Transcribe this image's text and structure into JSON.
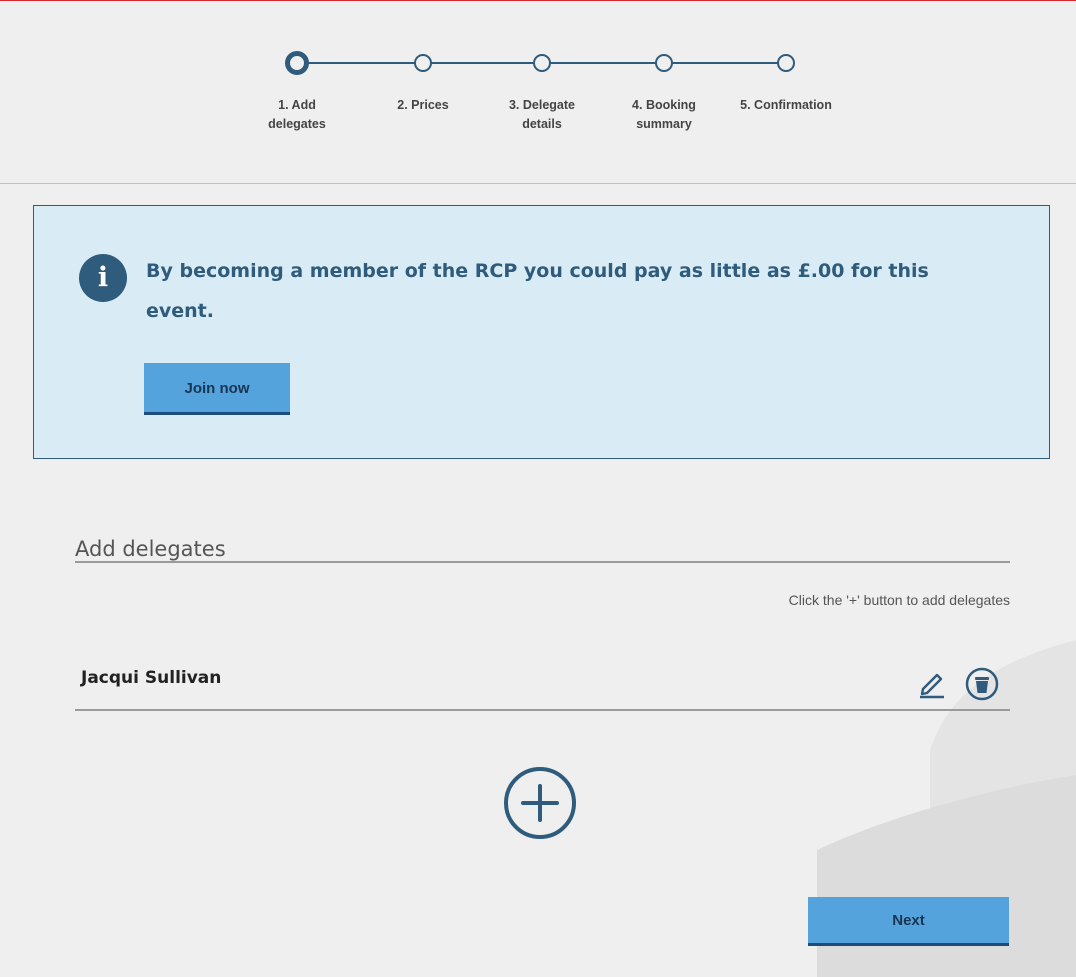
{
  "steps": [
    {
      "label": "1. Add\ndelegates",
      "active": true
    },
    {
      "label": "2. Prices",
      "active": false
    },
    {
      "label": "3. Delegate\ndetails",
      "active": false
    },
    {
      "label": "4. Booking\nsummary",
      "active": false
    },
    {
      "label": "5. Confirmation",
      "active": false
    }
  ],
  "info": {
    "icon": "info-icon",
    "glyph": "i",
    "message": "By becoming a member of the RCP you could pay as little as £.00 for this event.",
    "join_label": "Join now"
  },
  "delegates": {
    "title": "Add delegates",
    "hint": "Click the '+' button to add delegates",
    "items": [
      {
        "name": "Jacqui Sullivan"
      }
    ],
    "edit_icon": "pencil-icon",
    "delete_icon": "trash-icon",
    "add_icon": "plus-circle-icon"
  },
  "footer": {
    "next_label": "Next"
  },
  "colors": {
    "accent_dark": "#2f5b7c",
    "button": "#54a3dc",
    "panel_bg": "#d9ecf5",
    "top_rule": "#d7282f"
  }
}
